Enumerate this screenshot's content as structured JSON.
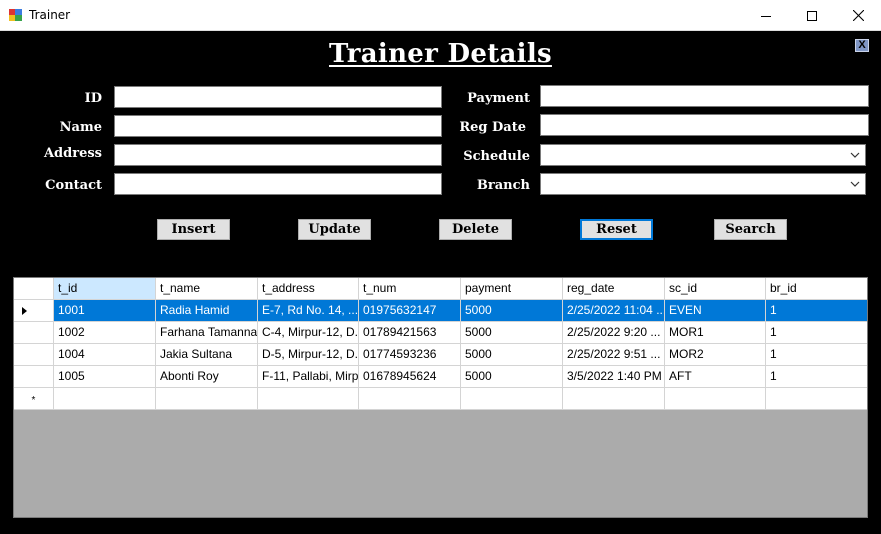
{
  "window": {
    "title": "Trainer"
  },
  "form": {
    "heading": "Trainer Details",
    "close_label": "X",
    "fields": {
      "id": {
        "label": "ID",
        "value": ""
      },
      "name": {
        "label": "Name",
        "value": ""
      },
      "address": {
        "label": "Address",
        "value": ""
      },
      "contact": {
        "label": "Contact",
        "value": ""
      },
      "payment": {
        "label": "Payment",
        "value": ""
      },
      "reg_date": {
        "label": "Reg Date",
        "value": ""
      },
      "schedule": {
        "label": "Schedule",
        "value": ""
      },
      "branch": {
        "label": "Branch",
        "value": ""
      }
    },
    "buttons": {
      "insert": "Insert",
      "update": "Update",
      "delete": "Delete",
      "reset": "Reset",
      "search": "Search"
    }
  },
  "grid": {
    "columns": [
      "t_id",
      "t_name",
      "t_address",
      "t_num",
      "payment",
      "reg_date",
      "sc_id",
      "br_id"
    ],
    "rows": [
      [
        "1001",
        "Radia Hamid",
        "E-7, Rd No. 14, ...",
        "01975632147",
        "5000",
        "2/25/2022 11:04 ...",
        "EVEN",
        "1"
      ],
      [
        "1002",
        "Farhana Tamanna",
        "C-4, Mirpur-12, D...",
        "01789421563",
        "5000",
        "2/25/2022 9:20 ...",
        "MOR1",
        "1"
      ],
      [
        "1004",
        "Jakia Sultana",
        "D-5, Mirpur-12, D...",
        "01774593236",
        "5000",
        "2/25/2022 9:51 ...",
        "MOR2",
        "1"
      ],
      [
        "1005",
        "Abonti Roy",
        "F-11, Pallabi, Mirp...",
        "01678945624",
        "5000",
        "3/5/2022 1:40 PM",
        "AFT",
        "1"
      ]
    ],
    "new_row_marker": "*",
    "selected_row": 0
  },
  "colors": {
    "accent": "#0078d7",
    "grid_background": "#ababab",
    "form_background": "#000000"
  }
}
